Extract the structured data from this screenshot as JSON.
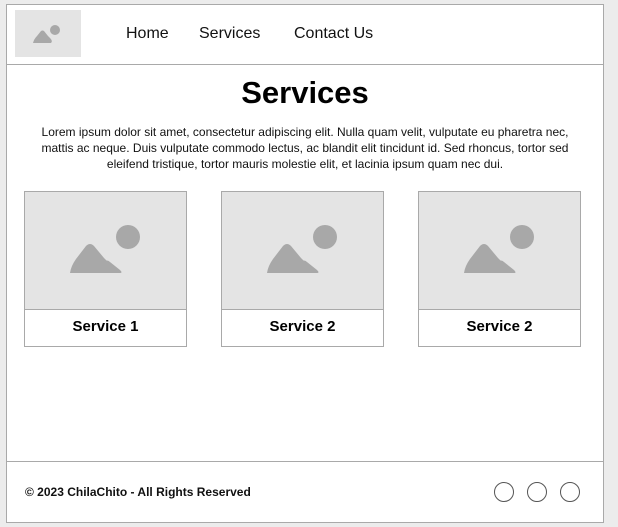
{
  "header": {
    "logo_icon": "image-placeholder-icon",
    "nav": {
      "home": "Home",
      "services": "Services",
      "contact": "Contact Us"
    }
  },
  "main": {
    "title": "Services",
    "intro": "Lorem ipsum dolor sit amet, consectetur adipiscing elit. Nulla quam velit, vulputate eu pharetra nec, mattis ac neque. Duis vulputate commodo lectus, ac blandit elit tincidunt id. Sed rhoncus, tortor sed eleifend tristique, tortor mauris molestie elit, et lacinia ipsum quam nec dui.",
    "cards": [
      {
        "label": "Service 1",
        "icon": "image-placeholder-icon"
      },
      {
        "label": "Service 2",
        "icon": "image-placeholder-icon"
      },
      {
        "label": "Service 2",
        "icon": "image-placeholder-icon"
      }
    ]
  },
  "footer": {
    "copyright": "© 2023 ChilaChito - All Rights Reserved",
    "social_icons": [
      "social-icon",
      "social-icon",
      "social-icon"
    ]
  },
  "colors": {
    "placeholder_bg": "#e4e4e4",
    "placeholder_icon": "#a8a8a8",
    "border": "#a9a9a9"
  }
}
